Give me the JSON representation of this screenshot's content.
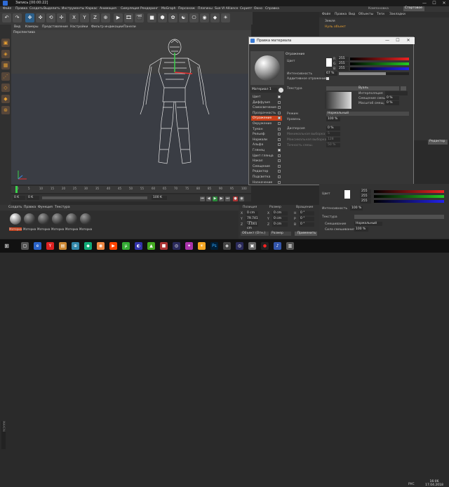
{
  "window": {
    "title": "Запись [00:00:22]",
    "min": "—",
    "max": "☐",
    "close": "✕"
  },
  "menubar": {
    "items": [
      "Файл",
      "Правка",
      "Создать",
      "Выделить",
      "Инструменты",
      "Каркас",
      "Анимация",
      "Симуляция",
      "Рендеринг",
      "MoGraph",
      "Персонаж",
      "Плагины",
      "Sue VI Alliance",
      "Скрипт",
      "Окно",
      "Справка"
    ],
    "layout_label": "Компоновка",
    "layout_value": "Стартовое"
  },
  "toolbar": {
    "icons": [
      "↶",
      "↷",
      "✥",
      "✜",
      "⟲",
      "✢",
      "X",
      "Y",
      "Z",
      "⊕",
      "▶",
      "🎞",
      "🎬",
      "■",
      "⬢",
      "✿",
      "☯",
      "⎔",
      "◉",
      "◆",
      "☀"
    ]
  },
  "viewport_menu": [
    "Вид",
    "Камеры",
    "Представление",
    "Настройки",
    "Фильтр индикации",
    "Панели"
  ],
  "viewport": {
    "label": "Перспектива"
  },
  "right_panel": {
    "tabs": [
      "Файл",
      "Правка",
      "Вид",
      "Объекты",
      "Теги",
      "Закладки"
    ],
    "objects": [
      "Земля",
      "Нуль объект"
    ],
    "attr_btn": "Редактор"
  },
  "dialog": {
    "title": "Правка материала",
    "material_name": "Материал 1",
    "channels": [
      {
        "label": "Цвет",
        "on": true
      },
      {
        "label": "Диффузия",
        "on": false
      },
      {
        "label": "Самосвечение",
        "on": false
      },
      {
        "label": "Прозрачность",
        "on": false
      },
      {
        "label": "Отражение",
        "on": true,
        "selected": true
      },
      {
        "label": "Окружение",
        "on": false
      },
      {
        "label": "Туман",
        "on": false
      },
      {
        "label": "Рельеф",
        "on": false
      },
      {
        "label": "Нормали",
        "on": false
      },
      {
        "label": "Альфа",
        "on": false
      },
      {
        "label": "Глянец",
        "on": true
      },
      {
        "label": "Цвет глянца",
        "on": false
      },
      {
        "label": "Накал",
        "on": false
      },
      {
        "label": "Смещение",
        "on": false
      },
      {
        "label": "Редактор",
        "on": false
      },
      {
        "label": "Подсветка",
        "on": false
      },
      {
        "label": "Назначение",
        "on": false
      }
    ],
    "section": "Отражение",
    "color_label": "Цвет",
    "rgb": [
      "255",
      "255",
      "255"
    ],
    "brightness_label": "Интенсивность",
    "brightness_val": "67 %",
    "additive_label": "Аддитивное отражение",
    "texture_label": "Текстура",
    "texture_val": "Вуаль",
    "interp_label": "Интерполяция",
    "offset_label": "Смещение смещ.",
    "offset_val": "0 %",
    "blur_label": "Масштаб смещ.",
    "blur_val": "0 %",
    "mode_label": "Режим",
    "mode_val": "Нормальный",
    "level_label": "Уровень",
    "level_val": "100 %",
    "dispersion_label": "Дисперсия",
    "dispersion_val": "0 %",
    "min_label": "Минимальная выборка",
    "min_val": "5",
    "max_label": "Максимальная выборка",
    "max_val": "128",
    "acc_label": "Точность смеш.",
    "acc_val": "50 %"
  },
  "timeline": {
    "ticks": [
      "0",
      "5",
      "10",
      "15",
      "20",
      "25",
      "30",
      "35",
      "40",
      "45",
      "50",
      "55",
      "60",
      "65",
      "70",
      "75",
      "80",
      "85",
      "90",
      "95",
      "100"
    ],
    "start": "0 K",
    "end": "100 K",
    "current": "0 K"
  },
  "material_bar": {
    "items": [
      "Создать",
      "Правка",
      "Функция",
      "Текстура"
    ]
  },
  "materials": [
    "Материал",
    "Материал",
    "Материал",
    "Материал",
    "Материал",
    "Материал"
  ],
  "coords": {
    "headers": [
      "Позиция",
      "Размер",
      "Вращение"
    ],
    "rows": [
      [
        "X",
        "0 cm",
        "X",
        "0 cm",
        "H",
        "0 °"
      ],
      [
        "Y",
        "79.741 cm",
        "Y",
        "0 cm",
        "P",
        "0 °"
      ],
      [
        "Z",
        "-3.001 cm",
        "Z",
        "0 cm",
        "B",
        "0 °"
      ]
    ],
    "mode": "Объект (Отн.)",
    "size_mode": "Размер",
    "apply": "Применить"
  },
  "attr": {
    "color_label": "Цвет",
    "rgb": [
      "255",
      "255",
      "255"
    ],
    "brightness_label": "Интенсивность",
    "brightness_val": "100 %",
    "texture_label": "Текстура",
    "mix_label": "Смешивание",
    "mix_val": "Нормальный",
    "blend_label": "Сила смешивания",
    "blend_val": "100 %"
  },
  "taskbar": {
    "time": "16:06",
    "date": "17.04.2018",
    "lang": "РУС"
  }
}
